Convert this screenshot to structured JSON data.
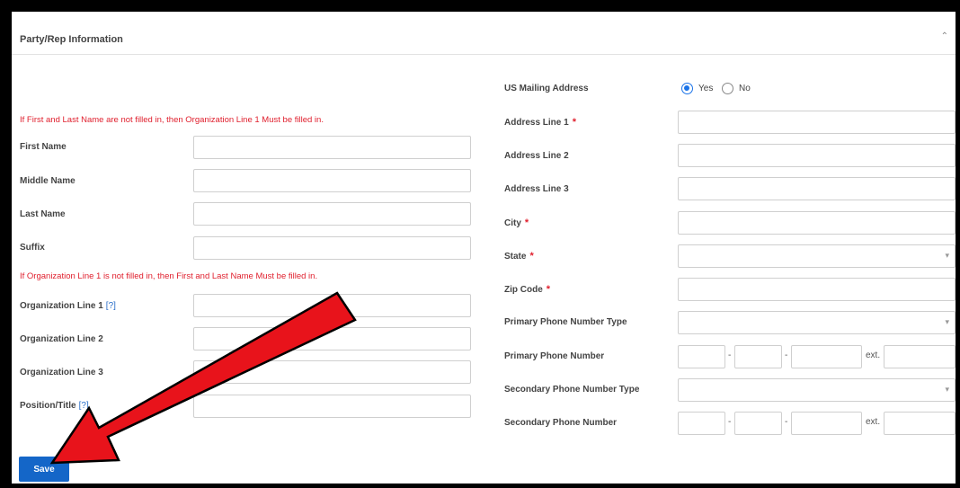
{
  "panel": {
    "title": "Party/Rep Information",
    "collapse_icon": "chevron-up-icon",
    "warn_name": "If First and Last Name are not filled in, then Organization Line 1 Must be filled in.",
    "warn_org": "If Organization Line 1 is not filled in, then First and Last Name Must be filled in.",
    "help_link": "[?]"
  },
  "left_fields": {
    "first_name": "First Name",
    "middle_name": "Middle Name",
    "last_name": "Last Name",
    "suffix": "Suffix",
    "org1": "Organization Line 1",
    "org2": "Organization Line 2",
    "org3": "Organization Line 3",
    "position": "Position/Title"
  },
  "right_fields": {
    "us_mailing": "US Mailing Address",
    "yes": "Yes",
    "no": "No",
    "us_mailing_selected": "Yes",
    "addr1": "Address Line 1",
    "addr2": "Address Line 2",
    "addr3": "Address Line 3",
    "city": "City",
    "state": "State",
    "zip": "Zip Code",
    "phone_type": "Primary Phone Number Type",
    "phone": "Primary Phone Number",
    "sec_phone_type": "Secondary Phone Number Type",
    "sec_phone": "Secondary Phone Number",
    "ext": "ext.",
    "dash": "-",
    "required_mark": "*"
  },
  "actions": {
    "save": "Save"
  },
  "colors": {
    "required": "#e0202e",
    "primary_button": "#1466c8",
    "annotation_arrow": "#e8131b"
  }
}
